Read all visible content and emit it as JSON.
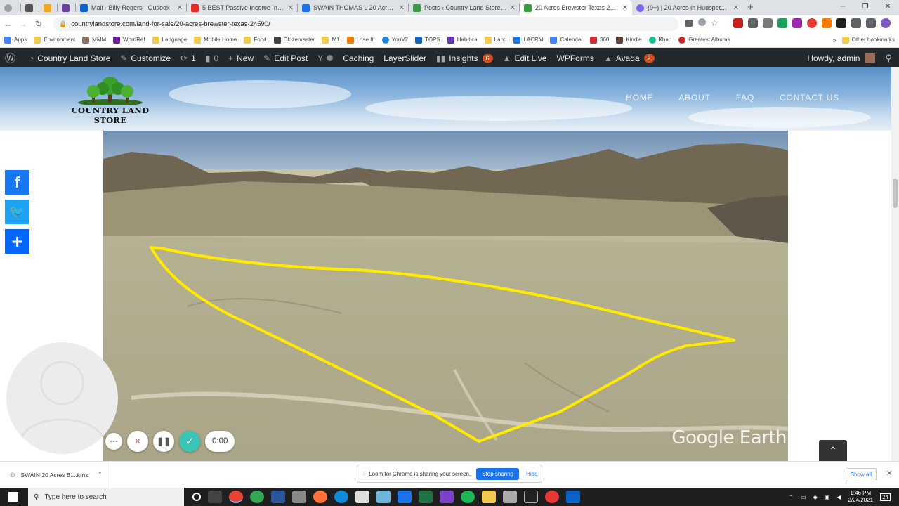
{
  "browser": {
    "tabs": [
      {
        "title": "",
        "active": false
      },
      {
        "title": "",
        "active": false
      },
      {
        "title": "",
        "active": false
      },
      {
        "title": "Mail - Billy Rogers - Outlook",
        "active": false
      },
      {
        "title": "5 BEST Passive Income Investme",
        "active": false
      },
      {
        "title": "SWAIN THOMAS L 20 Acres Brew",
        "active": false
      },
      {
        "title": "Posts ‹ Country Land Store — W",
        "active": false
      },
      {
        "title": "20 Acres Brewster Texas 24590 |",
        "active": true
      },
      {
        "title": "(9+) | 20 Acres in Hudspeth Texa",
        "active": false
      }
    ],
    "url": "countrylandstore.com/land-for-sale/20-acres-brewster-texas-24590/",
    "bookmarks": [
      "Apps",
      "Environment",
      "MMM",
      "WordRef",
      "Language",
      "Mobile Home",
      "Food",
      "Clozemaster",
      "M1",
      "Lose It!",
      "YouV2",
      "TOPS",
      "Habitica",
      "Land",
      "LACRM",
      "Calendar",
      "360",
      "Kindle",
      "Khan",
      "Greatest Albums"
    ],
    "other_bookmarks": "Other bookmarks"
  },
  "wp_admin_bar": {
    "site_name": "Country Land Store",
    "customize": "Customize",
    "updates": "1",
    "comments": "0",
    "new": "New",
    "edit_post": "Edit Post",
    "caching": "Caching",
    "layerslider": "LayerSlider",
    "insights": "Insights",
    "insights_count": "6",
    "edit_live": "Edit Live",
    "wpforms": "WPForms",
    "avada": "Avada",
    "avada_count": "2",
    "howdy": "Howdy, admin"
  },
  "site": {
    "logo_text": "COUNTRY LAND STORE",
    "nav": [
      "HOME",
      "ABOUT",
      "FAQ",
      "CONTACT US"
    ]
  },
  "media": {
    "watermark": "Google Earth"
  },
  "recorder": {
    "timer": "0:00"
  },
  "downloads": {
    "file": "SWAIN 20 Acres B....kmz",
    "sharing_message": "Loom for Chrome is sharing your screen.",
    "stop_sharing": "Stop sharing",
    "hide": "Hide",
    "show_all": "Show all"
  },
  "taskbar": {
    "search_placeholder": "Type here to search",
    "time": "1:46 PM",
    "date": "2/24/2021",
    "notification_count": "24"
  },
  "colors": {
    "wp_bar": "#23282d",
    "badge": "#d54e21",
    "boundary": "#ffea00",
    "loom_check": "#3bc5b6"
  }
}
